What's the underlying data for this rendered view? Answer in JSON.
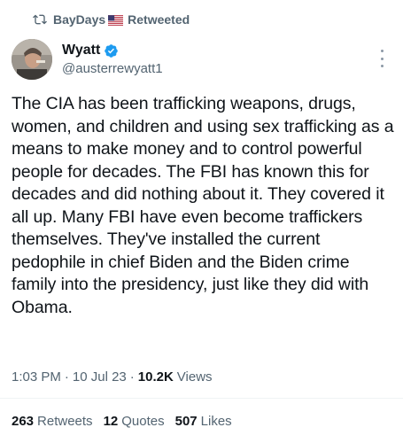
{
  "retweet_banner": {
    "user": "BayDays",
    "label": "Retweeted",
    "icon": "retweet-icon",
    "flag": "us-flag-icon"
  },
  "author": {
    "display_name": "Wyatt",
    "handle": "@austerrewyatt1",
    "verified": true,
    "verified_color": "#1d9bf0"
  },
  "tweet": {
    "text": "The CIA has been trafficking weapons, drugs, women, and children and using sex trafficking as a means to make money and to control powerful people for decades. The FBI has known this for decades and did nothing about it. They covered it all up. Many FBI have even become traffickers themselves. They've installed the current pedophile in chief Biden and the Biden crime family into the presidency, just like they did with Obama."
  },
  "meta": {
    "time": "1:03 PM",
    "sep1": "·",
    "date": "10 Jul 23",
    "sep2": "·",
    "views_count": "10.2K",
    "views_label": "Views"
  },
  "stats": {
    "retweets_count": "263",
    "retweets_label": "Retweets",
    "quotes_count": "12",
    "quotes_label": "Quotes",
    "likes_count": "507",
    "likes_label": "Likes"
  },
  "colors": {
    "text_primary": "#0f1419",
    "text_secondary": "#536471",
    "divider": "#eff3f4"
  }
}
